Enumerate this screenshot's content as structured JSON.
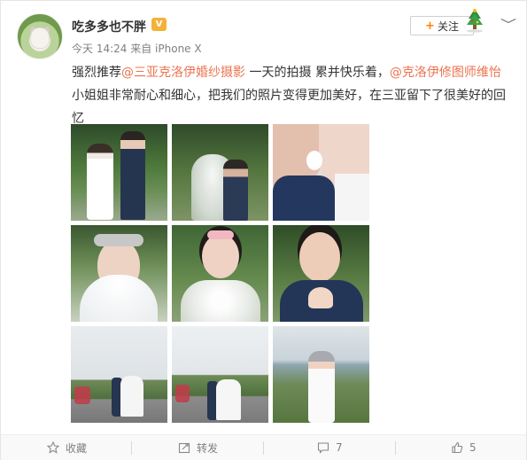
{
  "user": {
    "name": "吃多多也不胖",
    "badge_label": "VIP",
    "time": "今天 14:24",
    "source": "来自 iPhone X"
  },
  "header": {
    "follow_label": "关注",
    "follow_icon": "plus-icon",
    "menu_icon": "chevron-down-icon",
    "decoration_icon": "christmas-tree-icon"
  },
  "post": {
    "part1": "强烈推荐",
    "mention1": "@三亚克洛伊婚纱摄影",
    "part2": " 一天的拍摄  累并快乐着，",
    "mention2": "@克洛伊修图师维怡",
    "part3": " 小姐姐非常耐心和细心，把我们的照片变得更加美好，在三亚留下了很美好的回忆"
  },
  "photos": [
    "bride-and-groom-palms",
    "bride-veil-kiss",
    "couple-closeup-kiss",
    "bride-heart-hands",
    "bride-flower-crown",
    "groom-heart-hands",
    "couple-road-left",
    "couple-road-center",
    "bride-coast"
  ],
  "footer": {
    "favorite_label": "收藏",
    "repost_label": "转发",
    "comment_count": "7",
    "like_count": "5"
  },
  "colors": {
    "mention": "#eb7350",
    "accent": "#ff8200",
    "muted": "#808080"
  }
}
